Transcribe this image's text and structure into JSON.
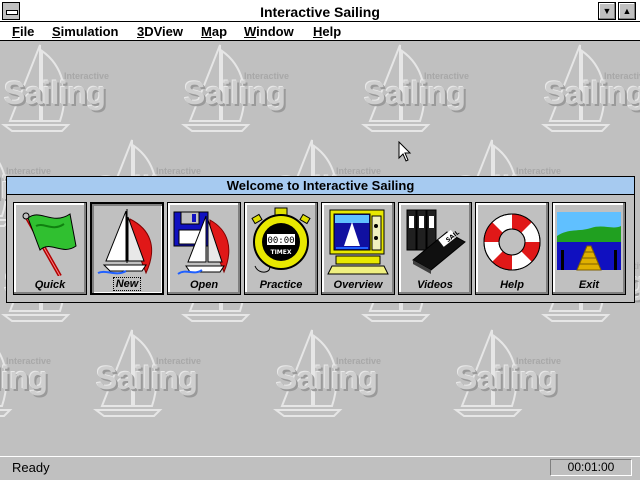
{
  "window": {
    "title": "Interactive Sailing"
  },
  "menu": [
    {
      "label": "File",
      "mnemonic": "F",
      "rest": "ile"
    },
    {
      "label": "Simulation",
      "mnemonic": "S",
      "rest": "imulation"
    },
    {
      "label": "3DView",
      "mnemonic": "3",
      "rest": "DView"
    },
    {
      "label": "Map",
      "mnemonic": "M",
      "rest": "ap"
    },
    {
      "label": "Window",
      "mnemonic": "W",
      "rest": "indow"
    },
    {
      "label": "Help",
      "mnemonic": "H",
      "rest": "elp"
    }
  ],
  "watermark": {
    "big": "Sailing",
    "small": "Interactive"
  },
  "dialog": {
    "title": "Welcome to Interactive Sailing",
    "tools": [
      {
        "label": "Quick",
        "icon": "green-flag-icon"
      },
      {
        "label": "New",
        "icon": "sailboat-icon"
      },
      {
        "label": "Open",
        "icon": "floppy-disk-sailboat-icon"
      },
      {
        "label": "Practice",
        "icon": "stopwatch-icon"
      },
      {
        "label": "Overview",
        "icon": "computer-monitor-icon"
      },
      {
        "label": "Videos",
        "icon": "video-tapes-icon"
      },
      {
        "label": "Help",
        "icon": "life-ring-icon"
      },
      {
        "label": "Exit",
        "icon": "dock-pier-icon"
      }
    ],
    "stopwatch_text": "00:00",
    "stopwatch_brand": "TIMEX",
    "tape_text": "SAIL"
  },
  "status": {
    "left": "Ready",
    "right": "00:01:00"
  },
  "colors": {
    "dialog_title_bg": "#a6caf0",
    "desktop_bg": "#c0c0c0",
    "sail_red": "#e01818",
    "flag_green": "#30c030"
  }
}
